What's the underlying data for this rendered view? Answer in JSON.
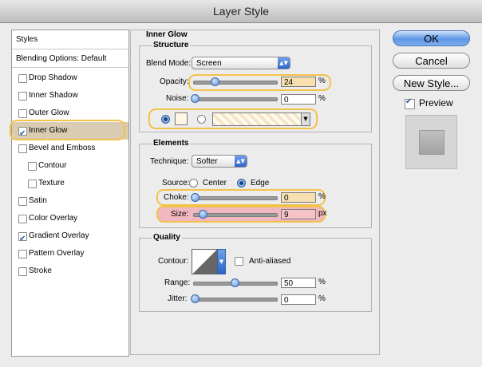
{
  "window": {
    "title": "Layer Style"
  },
  "styles_list": {
    "header": "Styles",
    "blending": "Blending Options: Default",
    "items": [
      {
        "label": "Drop Shadow",
        "checked": false
      },
      {
        "label": "Inner Shadow",
        "checked": false
      },
      {
        "label": "Outer Glow",
        "checked": false
      },
      {
        "label": "Inner Glow",
        "checked": true,
        "selected": true
      },
      {
        "label": "Bevel and Emboss",
        "checked": false
      },
      {
        "label": "Contour",
        "checked": false,
        "indent": true
      },
      {
        "label": "Texture",
        "checked": false,
        "indent": true
      },
      {
        "label": "Satin",
        "checked": false
      },
      {
        "label": "Color Overlay",
        "checked": false
      },
      {
        "label": "Gradient Overlay",
        "checked": true
      },
      {
        "label": "Pattern Overlay",
        "checked": false
      },
      {
        "label": "Stroke",
        "checked": false
      }
    ]
  },
  "panel": {
    "title": "Inner Glow",
    "structure": {
      "title": "Structure",
      "blend_mode_label": "Blend Mode:",
      "blend_mode": "Screen",
      "opacity_label": "Opacity:",
      "opacity": "24",
      "opacity_unit": "%",
      "noise_label": "Noise:",
      "noise": "0",
      "noise_unit": "%"
    },
    "elements": {
      "title": "Elements",
      "technique_label": "Technique:",
      "technique": "Softer",
      "source_label": "Source:",
      "source_center": "Center",
      "source_edge": "Edge",
      "choke_label": "Choke:",
      "choke": "0",
      "choke_unit": "%",
      "size_label": "Size:",
      "size": "9",
      "size_unit": "px"
    },
    "quality": {
      "title": "Quality",
      "contour_label": "Contour:",
      "antialiased_label": "Anti-aliased",
      "range_label": "Range:",
      "range": "50",
      "range_unit": "%",
      "jitter_label": "Jitter:",
      "jitter": "0",
      "jitter_unit": "%"
    }
  },
  "buttons": {
    "ok": "OK",
    "cancel": "Cancel",
    "new_style": "New Style...",
    "preview_label": "Preview",
    "preview_checked": true
  },
  "colors": {
    "highlight": "#f3c24a",
    "size_highlight": "#f0b8c0",
    "selected_row": "#d9ccb2",
    "accent": "#5d97e6"
  },
  "icons": {
    "checkmark": "checkmark-icon",
    "popup": "popup-arrow-icon",
    "gradient_dropdown": "chevron-down-icon"
  }
}
